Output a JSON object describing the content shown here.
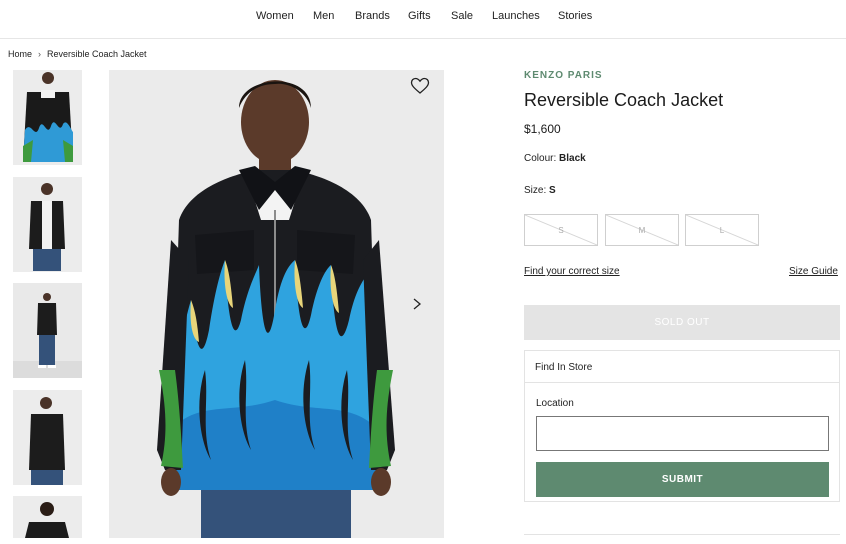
{
  "nav": {
    "items": [
      {
        "label": "Women"
      },
      {
        "label": "Men"
      },
      {
        "label": "Brands"
      },
      {
        "label": "Gifts"
      },
      {
        "label": "Sale"
      },
      {
        "label": "Launches"
      },
      {
        "label": "Stories"
      }
    ]
  },
  "breadcrumb": {
    "home": "Home",
    "separator": "›",
    "current": "Reversible Coach Jacket"
  },
  "product": {
    "brand": "KENZO PARIS",
    "title": "Reversible Coach Jacket",
    "price": "$1,600",
    "colour_label": "Colour:",
    "colour_value": "Black",
    "size_label": "Size:",
    "size_value": "S",
    "sizes": [
      {
        "label": "S",
        "available": false
      },
      {
        "label": "M",
        "available": false
      },
      {
        "label": "L",
        "available": false
      }
    ],
    "find_size_link": "Find your correct size",
    "size_guide_link": "Size Guide",
    "sold_out_label": "SOLD OUT"
  },
  "store": {
    "heading": "Find In Store",
    "location_label": "Location",
    "location_value": "",
    "submit_label": "SUBMIT"
  },
  "icons": {
    "wishlist": "heart-icon",
    "next": "chevron-right-icon",
    "breadcrumb_sep": "chevron-right-icon"
  },
  "colors": {
    "accent": "#5e8a70",
    "sold_out_bg": "#e4e4e4"
  }
}
